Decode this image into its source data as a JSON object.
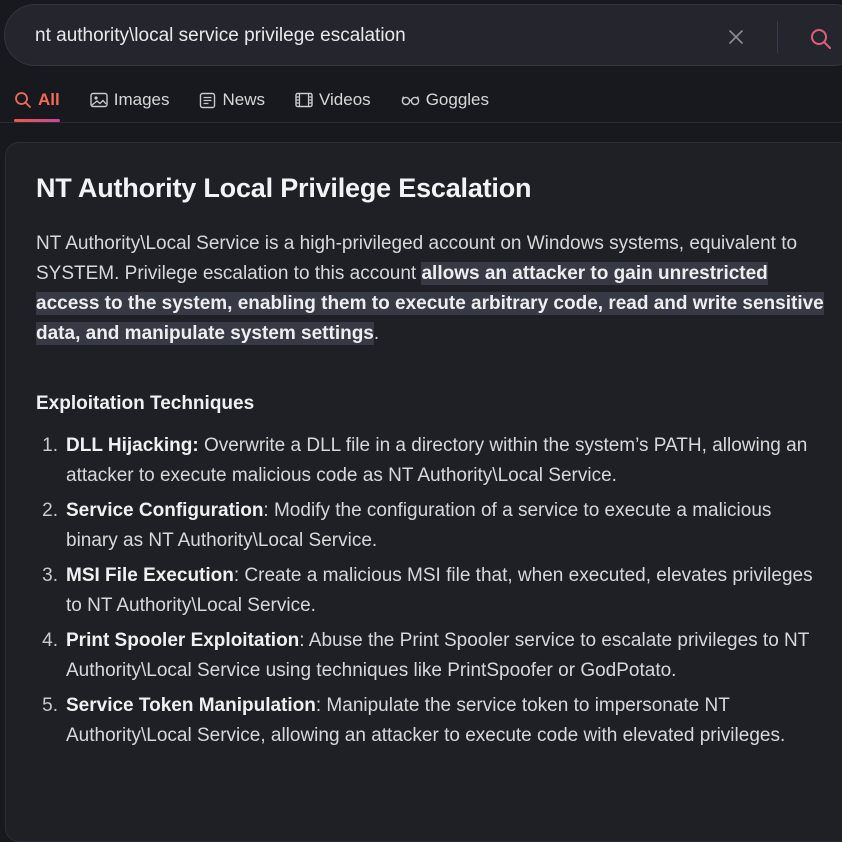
{
  "search": {
    "query": "nt authority\\local service privilege escalation"
  },
  "tabs": [
    {
      "label": "All",
      "icon": "search-icon",
      "active": true
    },
    {
      "label": "Images",
      "icon": "image-icon",
      "active": false
    },
    {
      "label": "News",
      "icon": "news-icon",
      "active": false
    },
    {
      "label": "Videos",
      "icon": "video-icon",
      "active": false
    },
    {
      "label": "Goggles",
      "icon": "goggles-icon",
      "active": false
    }
  ],
  "colors": {
    "accent": "#f26a58",
    "accent_gradient_end": "#c6469a",
    "background": "#18191e",
    "card": "#1f2026",
    "highlight": "#373a44"
  },
  "answer": {
    "title": "NT Authority Local Privilege Escalation",
    "intro_plain": "NT Authority\\Local Service is a high-privileged account on Windows systems, equivalent to SYSTEM. Privilege escalation to this account ",
    "intro_highlight": "allows an attacker to gain unrestricted access to the system, enabling them to execute arbitrary code, read and write sensitive data, and manipulate system settings",
    "intro_end": ".",
    "section_title": "Exploitation Techniques",
    "techniques": [
      {
        "num": "1.",
        "name": "DLL Hijacking:",
        "text": " Overwrite a DLL file in a directory within the system’s PATH, allowing an attacker to execute malicious code as NT Authority\\Local Service."
      },
      {
        "num": "2.",
        "name": "Service Configuration",
        "text": ": Modify the configuration of a service to execute a malicious binary as NT Authority\\Local Service."
      },
      {
        "num": "3.",
        "name": "MSI File Execution",
        "text": ": Create a malicious MSI file that, when executed, elevates privileges to NT Authority\\Local Service."
      },
      {
        "num": "4.",
        "name": "Print Spooler Exploitation",
        "text": ": Abuse the Print Spooler service to escalate privileges to NT Authority\\Local Service using techniques like PrintSpoofer or GodPotato."
      },
      {
        "num": "5.",
        "name": "Service Token Manipulation",
        "text": ": Manipulate the service token to impersonate NT Authority\\Local Service, allowing an attacker to execute code with elevated privileges."
      }
    ]
  }
}
